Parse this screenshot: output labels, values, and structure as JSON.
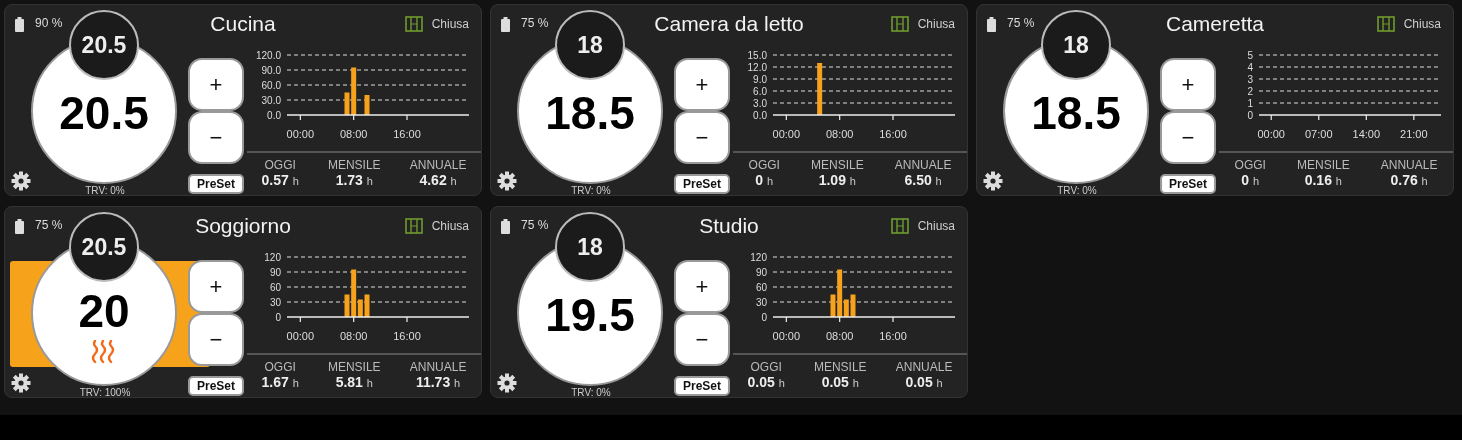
{
  "rooms": [
    {
      "name": "Cucina",
      "battery": "90 %",
      "target": "20.5",
      "current": "20.5",
      "heating": false,
      "trv": "TRV: 0%",
      "window": "Chiusa",
      "plus": "+",
      "minus": "−",
      "preset": "PreSet",
      "chart_data": {
        "type": "bar",
        "grid": true,
        "x": [
          7,
          8,
          10
        ],
        "values": [
          45,
          95,
          40
        ],
        "xlim": [
          -2,
          25.3
        ],
        "ylim": [
          0,
          120
        ],
        "xticks": [
          {
            "value": 0,
            "label": "00:00"
          },
          {
            "value": 8,
            "label": "08:00"
          },
          {
            "value": 16,
            "label": "16:00"
          }
        ],
        "yticks": [
          {
            "value": 0,
            "label": "0.0"
          },
          {
            "value": 30,
            "label": "30.0"
          },
          {
            "value": 60,
            "label": "60.0"
          },
          {
            "value": 90,
            "label": "90.0"
          },
          {
            "value": 120,
            "label": "120.0"
          }
        ]
      },
      "stats": [
        {
          "label": "OGGI",
          "value": "0.57",
          "unit": "h"
        },
        {
          "label": "MENSILE",
          "value": "1.73",
          "unit": "h"
        },
        {
          "label": "ANNUALE",
          "value": "4.62",
          "unit": "h"
        }
      ]
    },
    {
      "name": "Camera da letto",
      "battery": "75 %",
      "target": "18",
      "current": "18.5",
      "heating": false,
      "trv": "TRV: 0%",
      "window": "Chiusa",
      "plus": "+",
      "minus": "−",
      "preset": "PreSet",
      "chart_data": {
        "type": "bar",
        "grid": true,
        "x": [
          5
        ],
        "values": [
          13
        ],
        "xlim": [
          -2,
          25.3
        ],
        "ylim": [
          0,
          15
        ],
        "xticks": [
          {
            "value": 0,
            "label": "00:00"
          },
          {
            "value": 8,
            "label": "08:00"
          },
          {
            "value": 16,
            "label": "16:00"
          }
        ],
        "yticks": [
          {
            "value": 0,
            "label": "0.0"
          },
          {
            "value": 3,
            "label": "3.0"
          },
          {
            "value": 6,
            "label": "6.0"
          },
          {
            "value": 9,
            "label": "9.0"
          },
          {
            "value": 12,
            "label": "12.0"
          },
          {
            "value": 15,
            "label": "15.0"
          }
        ]
      },
      "stats": [
        {
          "label": "OGGI",
          "value": "0",
          "unit": "h"
        },
        {
          "label": "MENSILE",
          "value": "1.09",
          "unit": "h"
        },
        {
          "label": "ANNUALE",
          "value": "6.50",
          "unit": "h"
        }
      ]
    },
    {
      "name": "Cameretta",
      "battery": "75 %",
      "target": "18",
      "current": "18.5",
      "heating": false,
      "trv": "TRV: 0%",
      "window": "Chiusa",
      "plus": "+",
      "minus": "−",
      "preset": "PreSet",
      "chart_data": {
        "type": "bar",
        "grid": true,
        "xlim": [
          -1.8,
          25
        ],
        "ylim": [
          0,
          5
        ],
        "xticks": [
          {
            "value": 0,
            "label": "00:00"
          },
          {
            "value": 7,
            "label": "07:00"
          },
          {
            "value": 14,
            "label": "14:00"
          },
          {
            "value": 21,
            "label": "21:00"
          }
        ],
        "yticks": [
          0,
          1,
          2,
          3,
          4,
          5
        ]
      },
      "stats": [
        {
          "label": "OGGI",
          "value": "0",
          "unit": "h"
        },
        {
          "label": "MENSILE",
          "value": "0.16",
          "unit": "h"
        },
        {
          "label": "ANNUALE",
          "value": "0.76",
          "unit": "h"
        }
      ]
    },
    {
      "name": "Soggiorno",
      "battery": "75 %",
      "target": "20.5",
      "current": "20",
      "heating": true,
      "trv": "TRV: 100%",
      "window": "Chiusa",
      "plus": "+",
      "minus": "−",
      "preset": "PreSet",
      "chart_data": {
        "type": "bar",
        "grid": true,
        "x": [
          7,
          8,
          9,
          10
        ],
        "values": [
          45,
          95,
          35,
          45
        ],
        "xlim": [
          -2,
          25.3
        ],
        "ylim": [
          0,
          120
        ],
        "xticks": [
          {
            "value": 0,
            "label": "00:00"
          },
          {
            "value": 8,
            "label": "08:00"
          },
          {
            "value": 16,
            "label": "16:00"
          }
        ],
        "yticks": [
          0,
          30,
          60,
          90,
          120
        ]
      },
      "stats": [
        {
          "label": "OGGI",
          "value": "1.67",
          "unit": "h"
        },
        {
          "label": "MENSILE",
          "value": "5.81",
          "unit": "h"
        },
        {
          "label": "ANNUALE",
          "value": "11.73",
          "unit": "h"
        }
      ]
    },
    {
      "name": "Studio",
      "battery": "75 %",
      "target": "18",
      "current": "19.5",
      "heating": false,
      "trv": "TRV: 0%",
      "window": "Chiusa",
      "plus": "+",
      "minus": "−",
      "preset": "PreSet",
      "chart_data": {
        "type": "bar",
        "grid": true,
        "x": [
          7,
          8,
          9,
          10
        ],
        "values": [
          45,
          95,
          35,
          45
        ],
        "xlim": [
          -2,
          25.3
        ],
        "ylim": [
          0,
          120
        ],
        "xticks": [
          {
            "value": 0,
            "label": "00:00"
          },
          {
            "value": 8,
            "label": "08:00"
          },
          {
            "value": 16,
            "label": "16:00"
          }
        ],
        "yticks": [
          0,
          30,
          60,
          90,
          120
        ]
      },
      "stats": [
        {
          "label": "OGGI",
          "value": "0.05",
          "unit": "h"
        },
        {
          "label": "MENSILE",
          "value": "0.05",
          "unit": "h"
        },
        {
          "label": "ANNUALE",
          "value": "0.05",
          "unit": "h"
        }
      ]
    }
  ]
}
